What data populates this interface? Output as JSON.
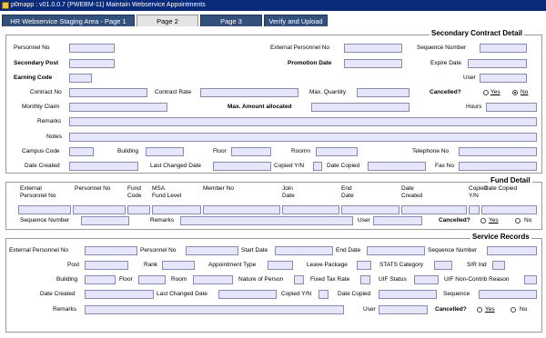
{
  "window": {
    "title": "p0mapp : v01.0.0.7 (PWEBM-11) Maintain Webservice Appointments"
  },
  "tabs": [
    "HR Webservice Staging Area - Page 1",
    "Page 2",
    "Page 3",
    "Verify and Upload"
  ],
  "secondary": {
    "title": "Secondary Contract Detail",
    "personnel_no": "Personnel No",
    "external_personnel_no": "External Personnel No",
    "sequence_number": "Sequence Number",
    "secondary_post": "Secondary Post",
    "promotion_date": "Promotion Date",
    "expire_date": "Expire Date",
    "earning_code": "Earning Code",
    "user": "User",
    "contract_no": "Contract No",
    "contract_rate": "Contract Rate",
    "max_quantity": "Max. Quantity",
    "cancelled": "Cancelled?",
    "yes": "Yes",
    "no": "No",
    "monthly_claim": "Monthly Claim",
    "max_amount": "Max. Amount allocated",
    "hours": "Hours",
    "remarks": "Remarks",
    "notes": "Notes",
    "campus_code": "Campus Code",
    "building": "Building",
    "floor": "Floor",
    "roomn": "Roomn",
    "telephone_no": "Telephone No",
    "date_created": "Date Created",
    "last_changed_date": "Last Changed Date",
    "copied_yn": "Copied Y/N",
    "date_copied": "Date Copied",
    "fax_no": "Fax No"
  },
  "fund": {
    "title": "Fund Detail",
    "headers": [
      [
        "External",
        "Personnel No"
      ],
      [
        "",
        "Personnel No"
      ],
      [
        "Fund",
        "Code"
      ],
      [
        "MSA",
        "Fund Level"
      ],
      [
        "",
        "Member No"
      ],
      [
        "Join",
        "Date"
      ],
      [
        "End",
        "Date"
      ],
      [
        "Date",
        "Created"
      ],
      [
        "Copied",
        "Y/N"
      ],
      [
        "",
        "Date Copied"
      ]
    ],
    "sequence_number": "Sequence Number",
    "remarks": "Remarks",
    "user": "User",
    "cancelled": "Cancelled?",
    "yes": "Yes",
    "no": "No"
  },
  "service": {
    "title": "Service Records",
    "external_personnel_no": "External Personnel No",
    "personnel_no": "Personnel No",
    "start_date": "Start Date",
    "end_date": "End Date",
    "sequence_number": "Sequence Number",
    "post": "Post",
    "rank": "Rank",
    "appointment_type": "Appointment Type",
    "leave_package": "Leave Package",
    "stats_category": "STATS Category",
    "sr_ind": "S/R Ind",
    "building": "Building",
    "floor": "Floor",
    "room": "Room",
    "nature_of_person": "Nature of Person",
    "fixed_tax_rate": "Fixed Tax Rate",
    "uif_status": "UIF Status",
    "uif_non_contrib": "UIF Non-Contrib Reason",
    "date_created": "Date Created",
    "last_changed_date": "Last Changed Date",
    "copied_yn": "Copied Y/N",
    "date_copied": "Date Copied",
    "sequence": "Sequence",
    "remarks": "Remarks",
    "user": "User",
    "cancelled": "Cancelled?",
    "yes": "Yes",
    "no": "No"
  }
}
